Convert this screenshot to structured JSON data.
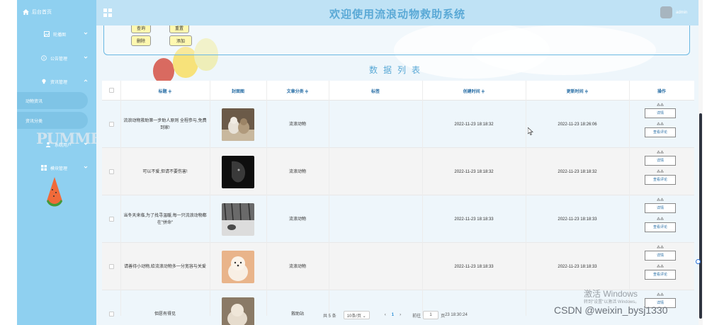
{
  "sidebar": {
    "top_label": "后台首页",
    "items": [
      {
        "label": "轮播图",
        "icon": "image-icon"
      },
      {
        "label": "公告管理",
        "icon": "info-icon"
      },
      {
        "label": "资讯管理",
        "icon": "bulb-icon"
      },
      {
        "label": "系统用户",
        "icon": "user-icon"
      },
      {
        "label": "模块管理",
        "icon": "grid-icon"
      }
    ],
    "subitems": [
      "动物资讯",
      "资讯分类"
    ],
    "logo_text": "PUMMER"
  },
  "header": {
    "title": "欢迎使用流浪动物救助系统",
    "username": "admin"
  },
  "toolbar": {
    "query_label": "查询",
    "reset_label": "重置",
    "delete_label": "删除",
    "add_label": "添加"
  },
  "section_title": "数据列表",
  "table": {
    "columns": [
      "标题 ≑",
      "封面图",
      "文章分类 ≑",
      "标签",
      "创建时间 ≑",
      "更新时间 ≑",
      "操作"
    ],
    "rows": [
      {
        "title": "流浪动物救助第一步助人原则 全程参与,免费到家!",
        "category": "流浪动物",
        "tag": "",
        "created": "2022-11-23 18:18:32",
        "updated": "2022-11-23 18:26:06",
        "thumb": "cats"
      },
      {
        "title": "可以不爱,但请不要伤害!",
        "category": "流浪动物",
        "tag": "",
        "created": "2022-11-23 18:18:32",
        "updated": "2022-11-23 18:18:32",
        "thumb": "blackdog"
      },
      {
        "title": "当冬天来临,为了找寻温暖,每一只流浪动物都在\"拼命\"",
        "category": "流浪动物",
        "tag": "",
        "created": "2022-11-23 18:18:33",
        "updated": "2022-11-23 18:18:33",
        "thumb": "snow"
      },
      {
        "title": "请善待小动物,给流浪动物多一分宽容与关爱",
        "category": "流浪动物",
        "tag": "",
        "created": "2022-11-23 18:18:33",
        "updated": "2022-11-23 18:18:33",
        "thumb": "puppy"
      },
      {
        "title": "但愿有得见",
        "category": "救助站",
        "tag": "",
        "created": "",
        "updated": "",
        "thumb": "dog2"
      }
    ],
    "op_detail": "详情",
    "op_comment": "查看评论"
  },
  "pager": {
    "total": "共 5 条",
    "page_size": "10条/页 ⌄",
    "current": "1",
    "goto_label": "前往",
    "goto_value": "1",
    "page_suffix": "页",
    "time_fragment": "23 18:30:24",
    "prev": "‹",
    "next": "›"
  },
  "watermark": {
    "line1": "激活 Windows",
    "line2": "转到\"设置\"以激活 Windows。",
    "csdn": "CSDN @weixin_bysj1330"
  }
}
